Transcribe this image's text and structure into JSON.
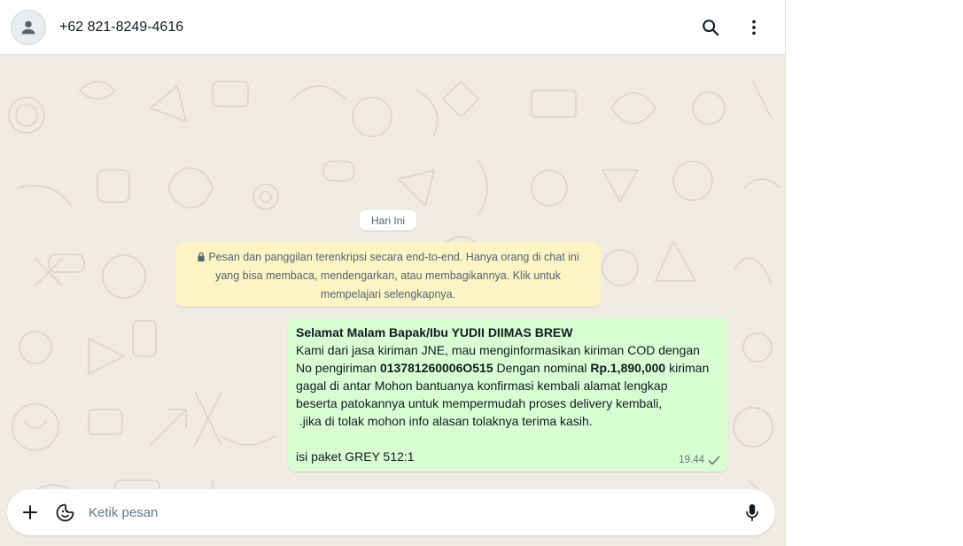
{
  "header": {
    "contact_name": "+62 821-8249-4616",
    "avatar_icon": "person-icon",
    "search_icon": "search-icon",
    "menu_icon": "more-vertical-icon"
  },
  "conversation": {
    "date_separator": "Hari Ini",
    "encryption_notice": {
      "line1": "Pesan dan panggilan terenkripsi secara end-to-end. Hanya orang di chat ini",
      "line2": "yang bisa membaca, mendengarkan, atau membagikannya. Klik untuk",
      "line3": "mempelajari selengkapnya.",
      "icon": "lock-icon"
    },
    "message": {
      "greeting": "Selamat Malam Bapak/Ibu YUDII DIIMAS BREW",
      "line2": "Kami dari jasa kiriman JNE, mau menginformasikan kiriman COD dengan",
      "line3_a": "No pengiriman ",
      "tracking_number": "013781260006O515",
      "line3_b": " Dengan nominal ",
      "amount": "Rp.1,890,000",
      "line3_c": " kiriman",
      "line4": "gagal di antar Mohon bantuanya konfirmasi kembali alamat lengkap",
      "line5": "beserta patokannya untuk mempermudah proses delivery kembali,",
      "line6": " .jika di tolak mohon info alasan tolaknya terima kasih.",
      "line8": "isi paket GREY 512:1",
      "time": "19.44",
      "status_icon": "single-check-icon"
    }
  },
  "composer": {
    "placeholder": "Ketik pesan",
    "value": "",
    "attach_icon": "plus-icon",
    "sticker_icon": "sticker-icon",
    "mic_icon": "microphone-icon"
  },
  "colors": {
    "chat_background": "#efeae2",
    "outgoing_bubble": "#d9fdd3",
    "system_notice": "#fdf4c5",
    "icon_gray": "#54656f"
  }
}
